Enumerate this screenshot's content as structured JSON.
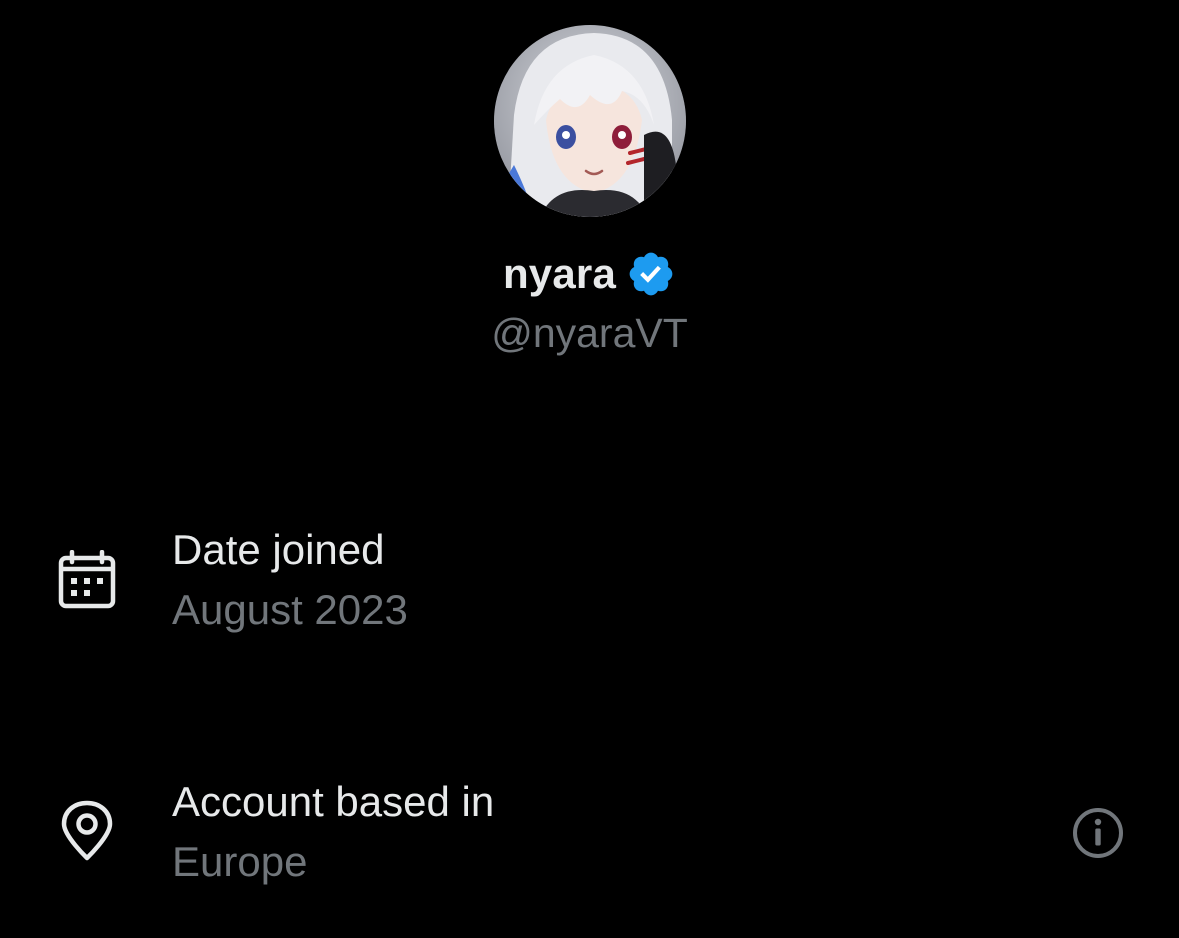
{
  "profile": {
    "display_name": "nyara",
    "handle": "@nyaraVT",
    "verified": true,
    "verified_color": "#1d9bf0"
  },
  "details": [
    {
      "icon": "calendar-icon",
      "title": "Date joined",
      "value": "August 2023"
    },
    {
      "icon": "location-pin-icon",
      "title": "Account based in",
      "value": "Europe",
      "action_icon": "info-icon"
    }
  ],
  "colors": {
    "background": "#000000",
    "primary_text": "#e7e9ea",
    "secondary_text": "#71767b"
  }
}
